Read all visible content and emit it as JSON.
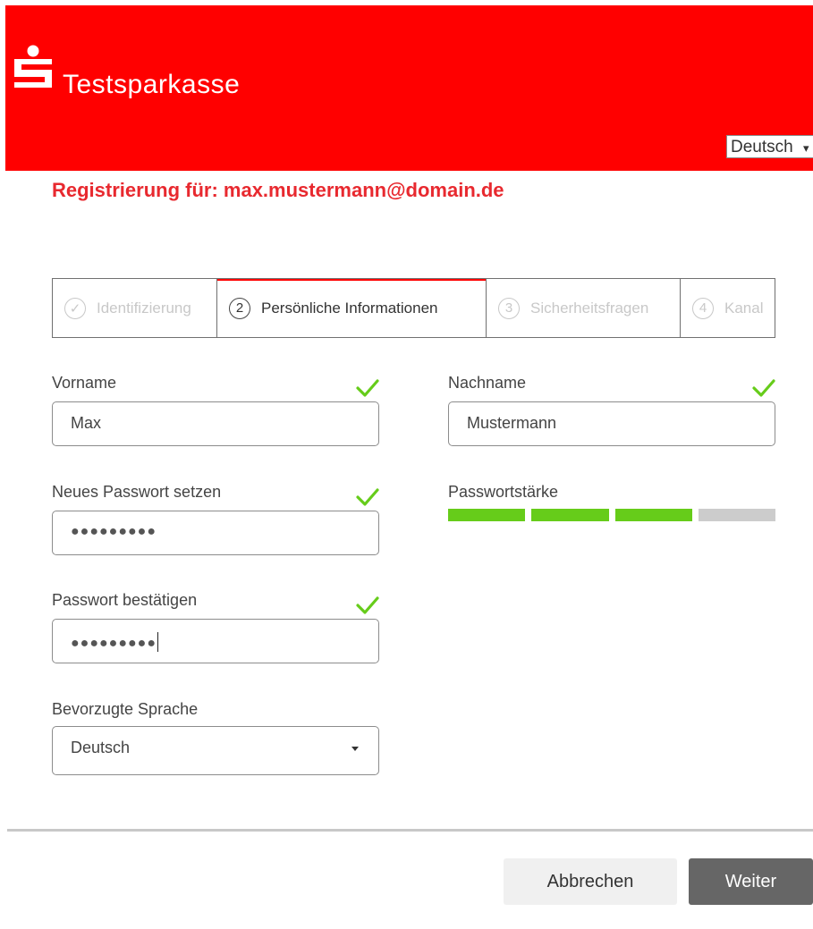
{
  "header": {
    "brand": "Testsparkasse",
    "language_select": {
      "selected": "Deutsch",
      "arrow": "▾"
    },
    "colors": {
      "brand_red": "#ff0000",
      "title_red": "#e8292f"
    }
  },
  "registration": {
    "title": "Registrierung für: max.mustermann@domain.de"
  },
  "steps": [
    {
      "number": "✓",
      "label": "Identifizierung",
      "state": "completed",
      "icon": "check-circle-icon"
    },
    {
      "number": "2",
      "label": "Persönliche Informationen",
      "state": "active"
    },
    {
      "number": "3",
      "label": "Sicherheitsfragen",
      "state": "upcoming"
    },
    {
      "number": "4",
      "label": "Kanal",
      "state": "upcoming"
    }
  ],
  "form": {
    "first_name": {
      "label": "Vorname",
      "value": "Max",
      "valid": true
    },
    "last_name": {
      "label": "Nachname",
      "value": "Mustermann",
      "valid": true
    },
    "new_password": {
      "label": "Neues Passwort setzen",
      "masked_value": "●●●●●●●●●",
      "valid": true
    },
    "confirm_password": {
      "label": "Passwort bestätigen",
      "masked_value": "●●●●●●●●●",
      "valid": true,
      "focused": true
    },
    "password_strength": {
      "label": "Passwortstärke",
      "filled_segments": 3,
      "total_segments": 4,
      "fill_color": "#66cc1a",
      "empty_color": "#cccccc"
    },
    "preferred_language": {
      "label": "Bevorzugte Sprache",
      "selected": "Deutsch"
    }
  },
  "actions": {
    "cancel_label": "Abbrechen",
    "next_label": "Weiter",
    "next_color": "#666666",
    "cancel_color": "#f0f0f0"
  },
  "icons": {
    "valid_check": "check-icon",
    "check_color": "#66cc1a"
  }
}
